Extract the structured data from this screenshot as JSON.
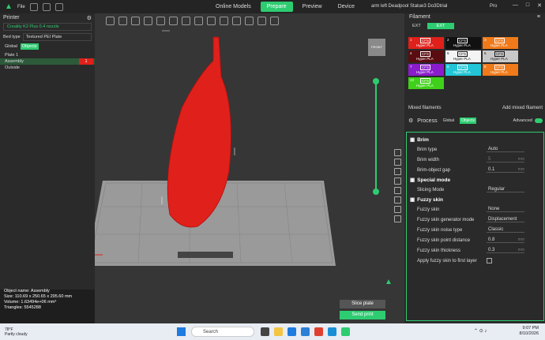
{
  "topbar": {
    "file_label": "File",
    "tabs": [
      "Online Models",
      "Prepare",
      "Preview",
      "Device"
    ],
    "active_tab": "Prepare",
    "doc_title": "arm left Deadpool Statue3 Do3Dtrial",
    "user": "Pro"
  },
  "left": {
    "title": "Printer",
    "printer": "Creality K2 Plus 0.4 nozzle",
    "bed_type_label": "Bed type",
    "bed_type_value": "Textured PEI Plate",
    "tab_global": "Global",
    "tab_objects": "Objects",
    "plate": "Plate 1",
    "assembly": "Assembly",
    "assembly_count": "1",
    "outside": "Outside"
  },
  "info": {
    "object_name": "Object name: Assembly",
    "size": "Size: 110.69 x 250.65 x 295.60 mm",
    "volume": "Volume: 1.63494e+06 mm³",
    "triangles": "Triangles: 5545288"
  },
  "viewport": {
    "front_label": "FRONT",
    "slice_label": "Slice plate",
    "send_label": "Send print"
  },
  "right": {
    "filament_title": "Filament",
    "ext_label": "EXT",
    "ext_tab": "EXT",
    "filaments": [
      {
        "num": "1",
        "cfs": "CFS",
        "type": "Hyper PLA",
        "bg": "#e0201a",
        "fg": "#ffffff"
      },
      {
        "num": "2",
        "cfs": "CFS",
        "type": "Hyper PLA",
        "bg": "#111111",
        "fg": "#ffffff"
      },
      {
        "num": "3",
        "cfs": "CFS",
        "type": "Hyper PLA",
        "bg": "#f07a1a",
        "fg": "#ffffff"
      },
      {
        "num": "4",
        "cfs": "CFS",
        "type": "Hyper PLA",
        "bg": "#5a0d10",
        "fg": "#ffffff"
      },
      {
        "num": "5",
        "cfs": "CFS",
        "type": "Hyper PLA",
        "bg": "#f4f4f4",
        "fg": "#111111"
      },
      {
        "num": "6",
        "cfs": "CFS",
        "type": "Hyper PLA",
        "bg": "#c8c8c8",
        "fg": "#111111"
      },
      {
        "num": "7",
        "cfs": "CFS",
        "type": "Hyper PLA",
        "bg": "#8a1ccc",
        "fg": "#ffffff"
      },
      {
        "num": "8",
        "cfs": "CFS",
        "type": "Hyper PLA",
        "bg": "#22c6d6",
        "fg": "#ffffff"
      },
      {
        "num": "9",
        "cfs": "CFS",
        "type": "Hyper PLA",
        "bg": "#f07a1a",
        "fg": "#ffffff"
      },
      {
        "num": "10",
        "cfs": "CFS",
        "type": "Hyper PLA",
        "bg": "#3fd11a",
        "fg": "#ffffff"
      }
    ],
    "mixed_label": "Mixed filaments",
    "add_mixed": "Add mixed filament",
    "process_title": "Process",
    "pill_global": "Global",
    "pill_objects": "Objects",
    "advanced": "Advanced",
    "brim_head": "Brim",
    "brim_type_label": "Brim type",
    "brim_type_val": "Auto",
    "brim_width_label": "Brim width",
    "brim_width_val": "5",
    "brim_gap_label": "Brim-object gap",
    "brim_gap_val": "0.1",
    "unit_mm": "mm",
    "special_head": "Special mode",
    "slicing_mode_label": "Slicing Mode",
    "slicing_mode_val": "Regular",
    "fuzzy_head": "Fuzzy skin",
    "fuzzy_label": "Fuzzy skin",
    "fuzzy_val": "None",
    "fuzzy_mode_label": "Fuzzy skin generator mode",
    "fuzzy_mode_val": "Displacement",
    "noise_label": "Fuzzy skin noise type",
    "noise_val": "Classic",
    "point_label": "Fuzzy skin point distance",
    "point_val": "0.8",
    "thick_label": "Fuzzy skin thickness",
    "thick_val": "0.3",
    "first_layer_label": "Apply fuzzy skin to first layer"
  },
  "taskbar": {
    "temp": "78°F",
    "weather": "Partly cloudy",
    "search": "Search",
    "time": "9:07 PM",
    "date": "8/10/2026"
  },
  "colors": {
    "accent": "#2ecc71",
    "model": "#e0201a"
  }
}
